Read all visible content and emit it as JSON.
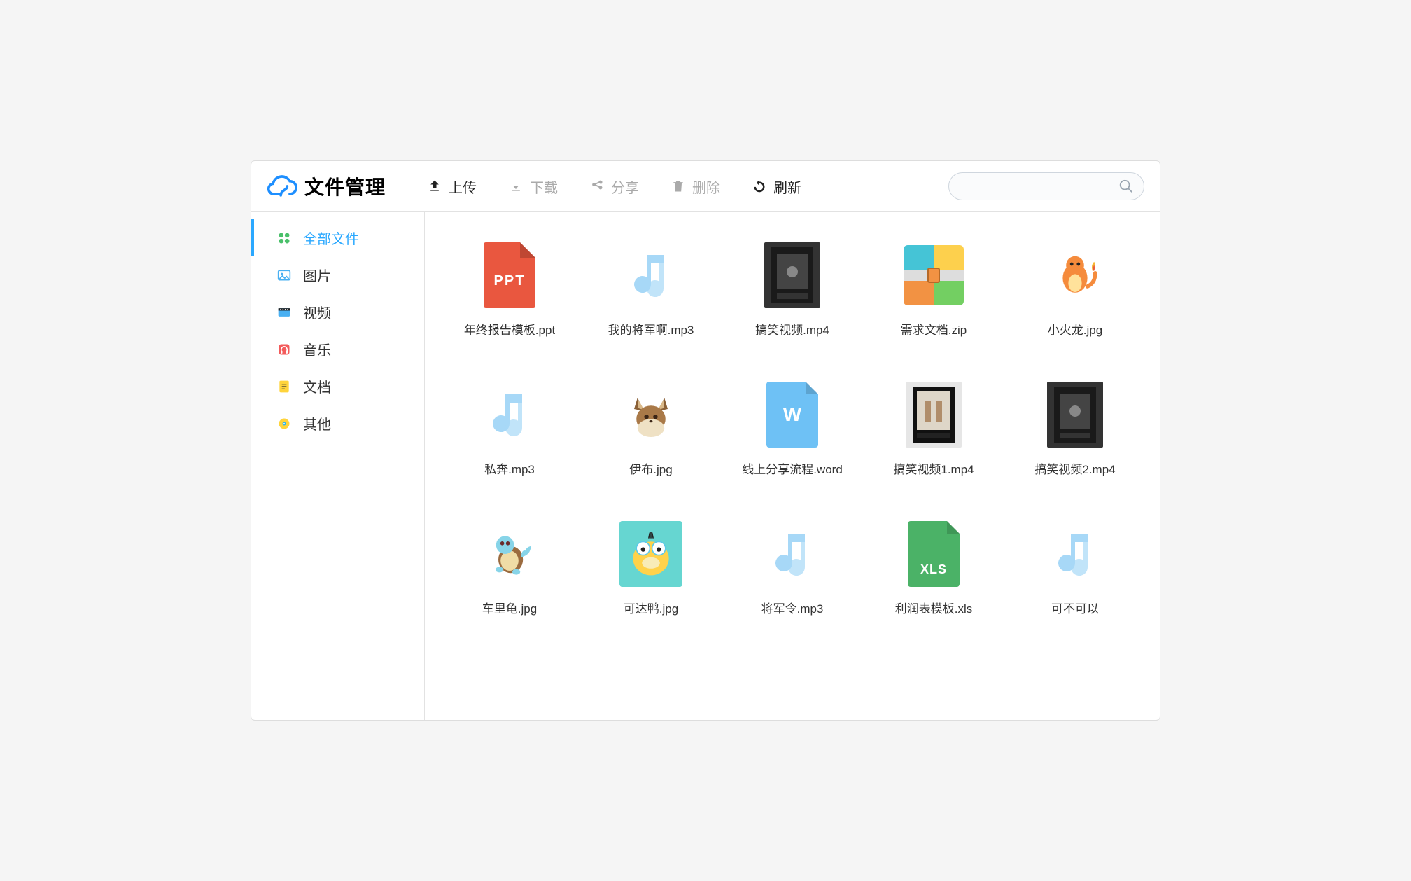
{
  "header": {
    "title": "文件管理",
    "toolbar": {
      "upload": "上传",
      "download": "下载",
      "share": "分享",
      "delete": "删除",
      "refresh": "刷新"
    },
    "search_placeholder": ""
  },
  "sidebar": {
    "items": [
      {
        "label": "全部文件",
        "icon": "all",
        "active": true
      },
      {
        "label": "图片",
        "icon": "image",
        "active": false
      },
      {
        "label": "视频",
        "icon": "video",
        "active": false
      },
      {
        "label": "音乐",
        "icon": "music",
        "active": false
      },
      {
        "label": "文档",
        "icon": "doc",
        "active": false
      },
      {
        "label": "其他",
        "icon": "other",
        "active": false
      }
    ]
  },
  "files": [
    {
      "name": "年终报告模板.ppt",
      "type": "ppt"
    },
    {
      "name": "我的将军啊.mp3",
      "type": "audio"
    },
    {
      "name": "搞笑视频.mp4",
      "type": "video-dark"
    },
    {
      "name": "需求文档.zip",
      "type": "zip"
    },
    {
      "name": "小火龙.jpg",
      "type": "image-charmander"
    },
    {
      "name": "私奔.mp3",
      "type": "audio"
    },
    {
      "name": "伊布.jpg",
      "type": "image-eevee"
    },
    {
      "name": "线上分享流程.word",
      "type": "word"
    },
    {
      "name": "搞笑视频1.mp4",
      "type": "video-light"
    },
    {
      "name": "搞笑视频2.mp4",
      "type": "video-dark"
    },
    {
      "name": "车里龟.jpg",
      "type": "image-squirtle"
    },
    {
      "name": "可达鸭.jpg",
      "type": "image-psyduck"
    },
    {
      "name": "将军令.mp3",
      "type": "audio"
    },
    {
      "name": "利润表模板.xls",
      "type": "xls"
    },
    {
      "name": "可不可以",
      "type": "audio"
    }
  ]
}
